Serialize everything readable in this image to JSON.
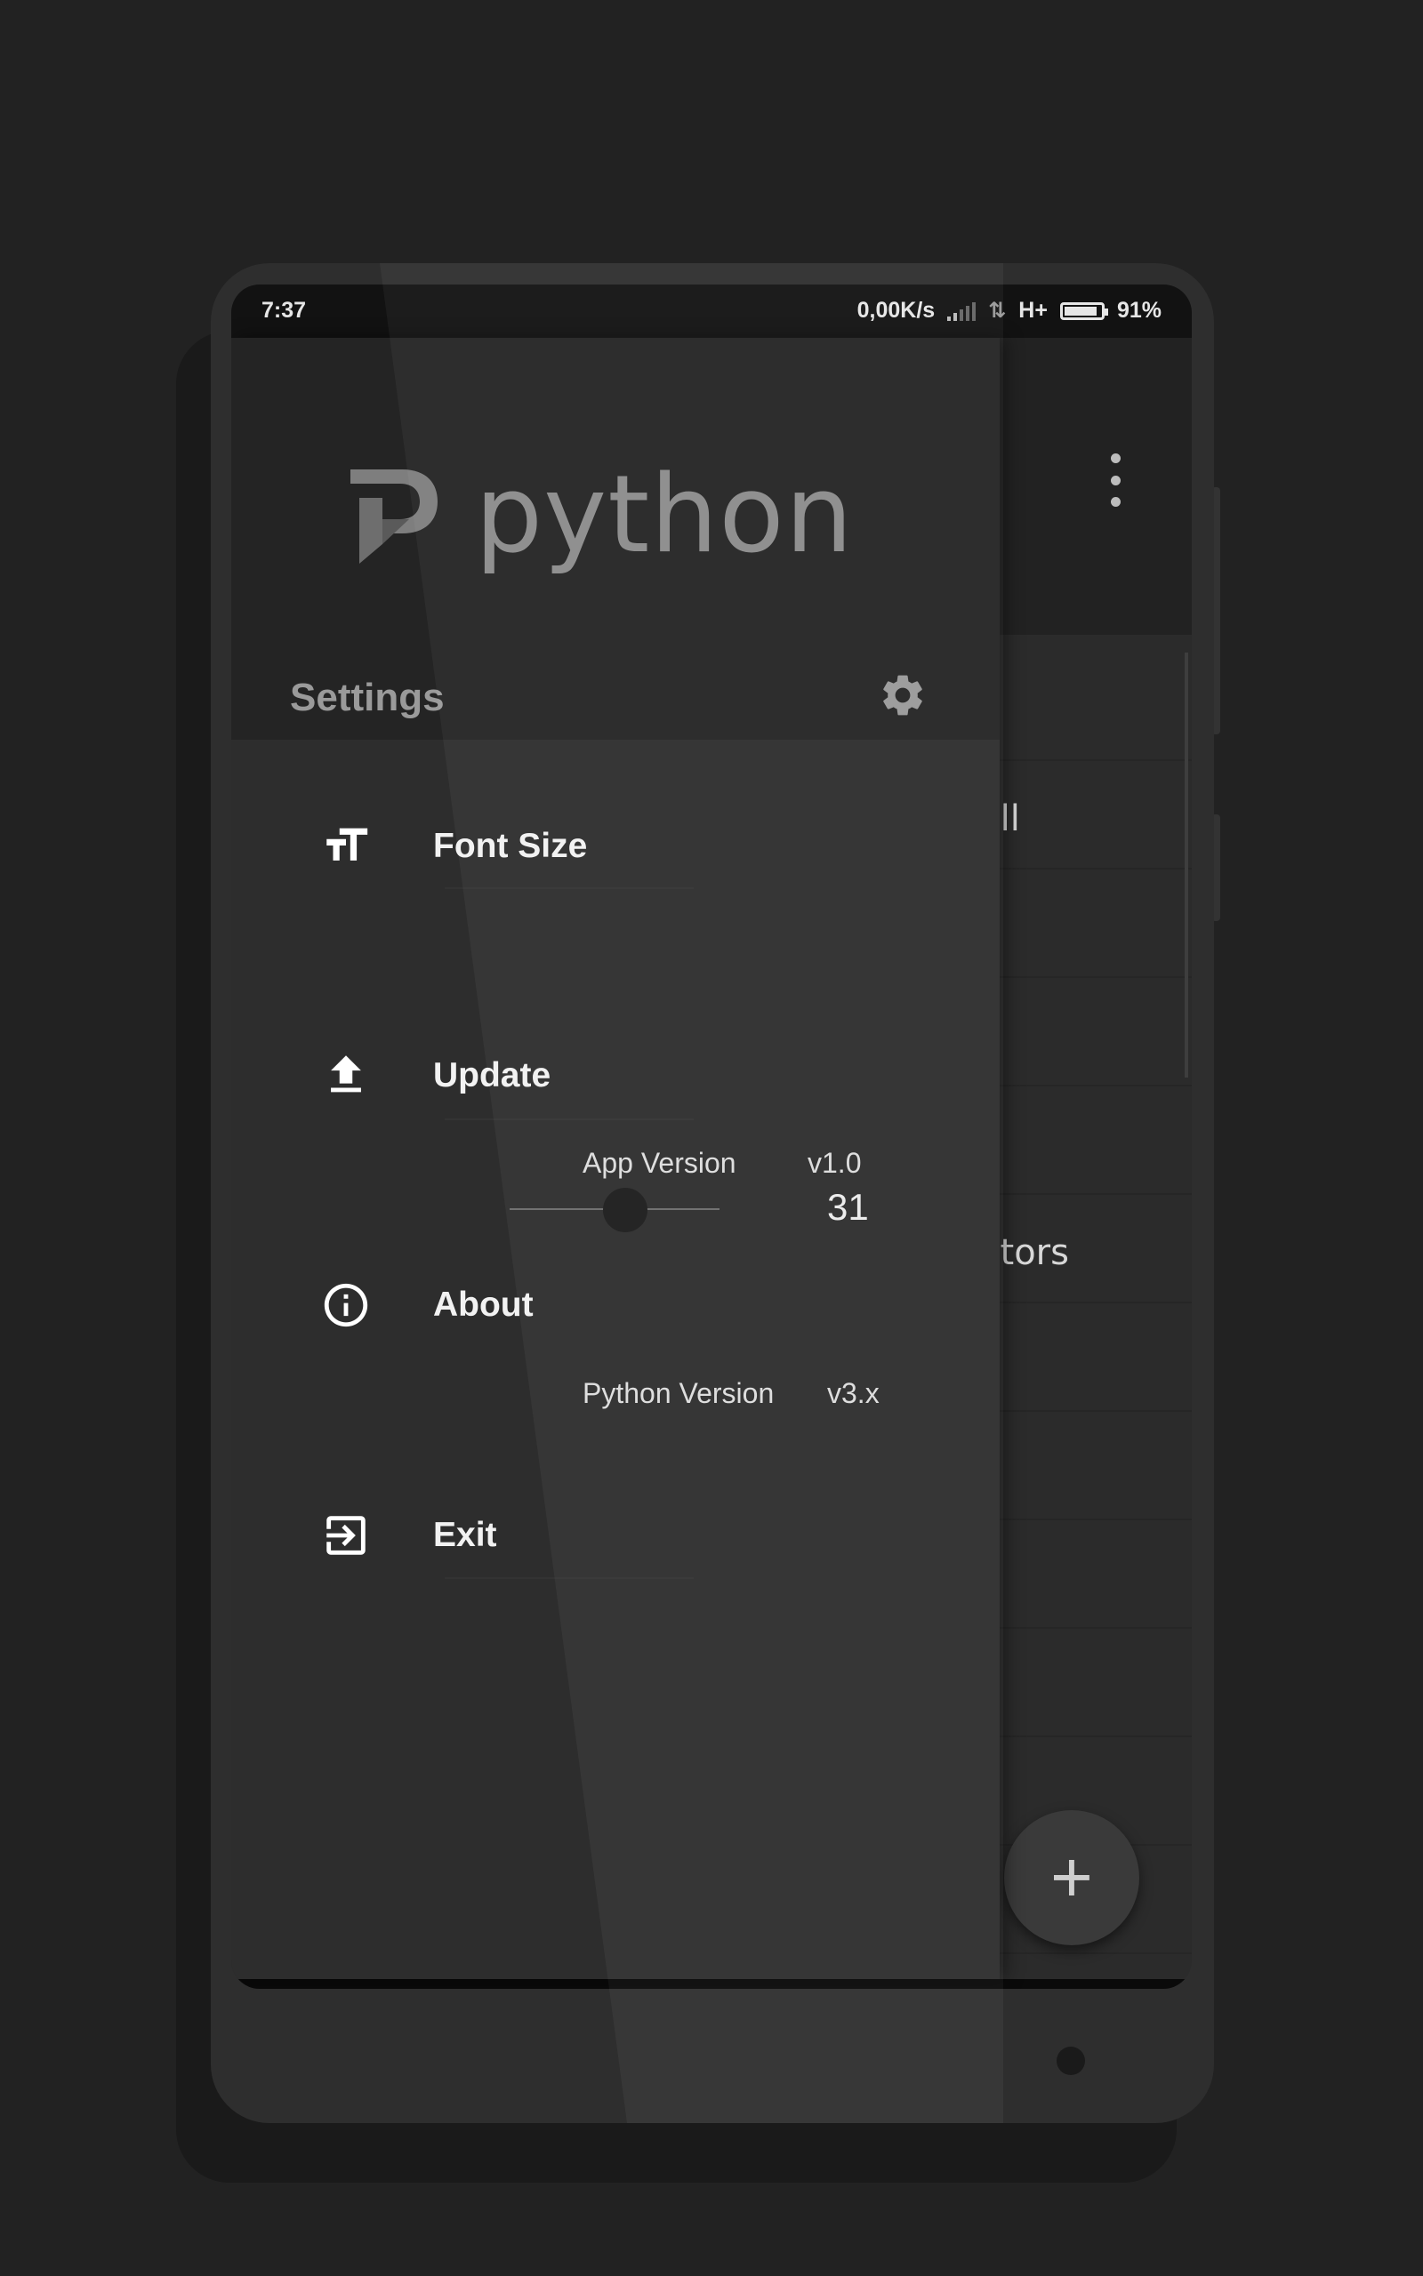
{
  "status_bar": {
    "time": "7:37",
    "network_speed": "0,00K/s",
    "network_type": "H+",
    "battery_percent": "91%",
    "battery_level": 0.91
  },
  "app_background": {
    "menu_icon": "more-vert-icon",
    "visible_list_fragments": [
      "ell",
      "ators"
    ],
    "fab_label": "+"
  },
  "drawer": {
    "logo_text": "python",
    "settings_title": "Settings",
    "settings_icon": "gear-icon",
    "items": [
      {
        "title": "Font Size",
        "icon": "font-size-icon"
      },
      {
        "title": "Update",
        "icon": "upload-icon",
        "sub_label": "App Version",
        "sub_value": "v1.0"
      },
      {
        "title": "About",
        "icon": "info-icon",
        "sub_label": "Python Version",
        "sub_value": "v3.x"
      },
      {
        "title": "Exit",
        "icon": "exit-icon"
      }
    ],
    "font_size_slider": {
      "value": "31",
      "position_fraction": 0.55
    }
  },
  "colors": {
    "page_background": "#222222",
    "phone_body": "#2e2e2e",
    "drawer_header": "#242424",
    "drawer_body": "#2d2d2d",
    "accent_text": "#f2f2f2",
    "muted_text": "#9a9a9a"
  }
}
